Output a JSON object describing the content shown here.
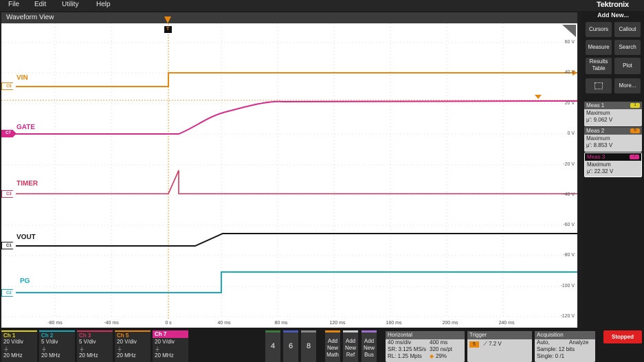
{
  "menu": {
    "file": "File",
    "edit": "Edit",
    "utility": "Utility",
    "help": "Help"
  },
  "brand": "Tektronix",
  "waveform_view": {
    "title": "Waveform View",
    "trigger_marker": "T"
  },
  "y_axis_labels": [
    "60 V",
    "40 V",
    "20 V",
    "0 V",
    "-20 V",
    "-40 V",
    "-60 V",
    "-80 V",
    "-100 V",
    "-120 V"
  ],
  "x_axis_labels": [
    "-80 ms",
    "-40 ms",
    "0 s",
    "40 ms",
    "80 ms",
    "120 ms",
    "160 ms",
    "200 ms",
    "240 ms"
  ],
  "channels": [
    {
      "name": "VIN",
      "tag": "C5",
      "color": "#e8860d"
    },
    {
      "name": "GATE",
      "tag": "C7",
      "color": "#d8288a"
    },
    {
      "name": "TIMER",
      "tag": "C3",
      "color": "#d2345d"
    },
    {
      "name": "VOUT",
      "tag": "C1",
      "color": "#141414"
    },
    {
      "name": "PG",
      "tag": "C2",
      "color": "#1aaabe"
    }
  ],
  "right_panel": {
    "add_new": "Add New...",
    "buttons": {
      "cursors": "Cursors",
      "callout": "Callout",
      "measure": "Measure",
      "search": "Search",
      "results_table_1": "Results",
      "results_table_2": "Table",
      "plot": "Plot",
      "more": "More..."
    },
    "measurements": [
      {
        "title": "Meas 1",
        "chip": "1",
        "chip_color": "#e0d020",
        "type": "Maximum",
        "value": "μ': 9.062 V"
      },
      {
        "title": "Meas 2",
        "chip": "5",
        "chip_color": "#e8860d",
        "type": "Maximum",
        "value": "μ': 8.853 V"
      },
      {
        "title": "Meas 3",
        "chip": "7",
        "chip_color": "#d8288a",
        "type": "Maximum",
        "value": "μ': 22.32 V"
      }
    ]
  },
  "channel_settings": [
    {
      "label": "Ch 1",
      "color": "#e0d020",
      "scale": "20 V/div",
      "bw": "20 MHz"
    },
    {
      "label": "Ch 2",
      "color": "#1aaabe",
      "scale": "5 V/div",
      "bw": "20 MHz"
    },
    {
      "label": "Ch 3",
      "color": "#d2345d",
      "scale": "5 V/div",
      "bw": "20 MHz"
    },
    {
      "label": "Ch 5",
      "color": "#e8860d",
      "scale": "20 V/div",
      "bw": "20 MHz"
    },
    {
      "label": "Ch 7",
      "color": "#d8288a",
      "scale": "20 V/div",
      "bw": "20 MHz"
    }
  ],
  "num_buttons": [
    "4",
    "6",
    "8"
  ],
  "add_buttons": [
    {
      "l1": "Add",
      "l2": "New",
      "l3": "Math",
      "color": "#e8860d"
    },
    {
      "l1": "Add",
      "l2": "New",
      "l3": "Ref",
      "color": "#cccccc"
    },
    {
      "l1": "Add",
      "l2": "New",
      "l3": "Bus",
      "color": "#a070d0"
    }
  ],
  "horizontal": {
    "title": "Horizontal",
    "row1a": "40 ms/div",
    "row1b": "400 ms",
    "row2a": "SR: 3.125 MS/s",
    "row2b": "320 ns/pt",
    "row3a": "RL: 1.25 Mpts",
    "row3b": "29%"
  },
  "trigger": {
    "title": "Trigger",
    "source": "5",
    "level": "7.2 V"
  },
  "acquisition": {
    "title": "Acquisition",
    "row1a": "Auto,",
    "row1b": "Analyze",
    "row2": "Sample: 12 bits",
    "row3": "Single: 0 /1"
  },
  "status": "Stopped"
}
